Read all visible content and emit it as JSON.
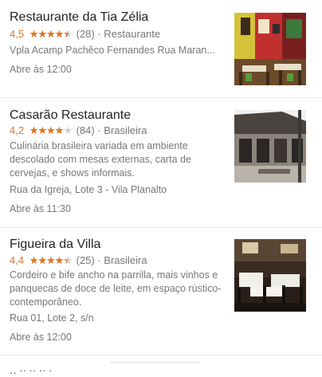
{
  "listings": [
    {
      "name": "Restaurante da Tia Zélia",
      "rating": "4,5",
      "rating_value": 4.5,
      "reviews": "(28)",
      "category": "· Restaurante",
      "address": "Vpla Acamp Pachêco Fernandes Rua Maran...",
      "hours": "Abre às 12:00",
      "photo_icon": "restaurant-photo-colorful-interior"
    },
    {
      "name": "Casarão Restaurante",
      "rating": "4,2",
      "rating_value": 4.2,
      "reviews": "(84)",
      "category": "· Brasileira",
      "description": "Culinária brasileira variada em ambiente descolado com mesas externas, carta de cervejas, e shows informais.",
      "address": "Rua da Igreja, Lote 3 - Vila Planalto",
      "hours": "Abre às 11:30",
      "photo_icon": "restaurant-photo-building-exterior"
    },
    {
      "name": "Figueira da Villa",
      "rating": "4,4",
      "rating_value": 4.4,
      "reviews": "(25)",
      "category": "· Brasileira",
      "description": "Cordeiro e bife ancho na parrilla, mais vinhos e panquecas de doce de leite, em espaço rústico-contemporâneo.",
      "address": "Rua 01, Lote 2, s/n",
      "hours": "Abre às 12:00",
      "photo_icon": "restaurant-photo-dining-room"
    }
  ],
  "stars_glyphs": "★★★★★",
  "bottom_fragment": "‥ ·· ·· ·· ·",
  "colors": {
    "accent_star": "#e7711b",
    "star_empty": "#cccccc",
    "secondary_text": "#777777"
  }
}
